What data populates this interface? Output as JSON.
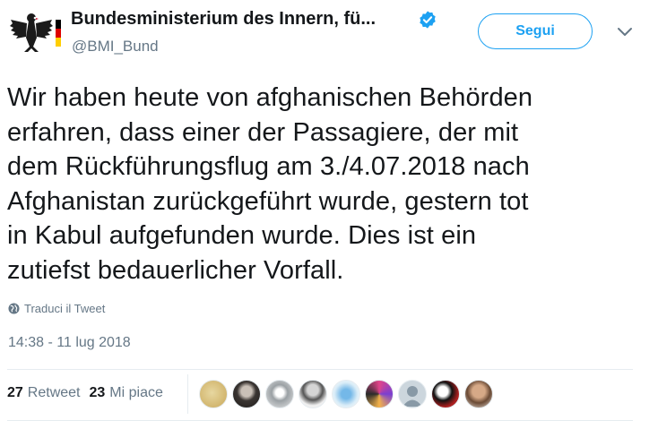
{
  "header": {
    "account_name": "Bundesministerium des Innern, fü...",
    "handle": "@BMI_Bund",
    "follow_label": "Segui"
  },
  "tweet": {
    "text": "Wir haben heute von afghanischen Behörden\nerfahren, dass einer der Passagiere, der mit\ndem Rückführungsflug am 3./4.07.2018 nach\nAfghanistan zurückgeführt wurde, gestern tot\nin Kabul aufgefunden wurde. Dies ist ein\nzutiefst bedauerlicher Vorfall.",
    "translate_label": "Traduci il Tweet",
    "timestamp": "14:38 - 11 lug 2018"
  },
  "stats": {
    "retweets_count": "27",
    "retweets_label": "Retweet",
    "likes_count": "23",
    "likes_label": "Mi piace"
  },
  "icons": {
    "verified": "verified-badge-icon",
    "menu": "chevron-down-icon",
    "translate": "globe-icon"
  },
  "colors": {
    "accent": "#1da1f2",
    "secondary_text": "#657786",
    "primary_text": "#14171a",
    "divider": "#e6ecf0"
  }
}
